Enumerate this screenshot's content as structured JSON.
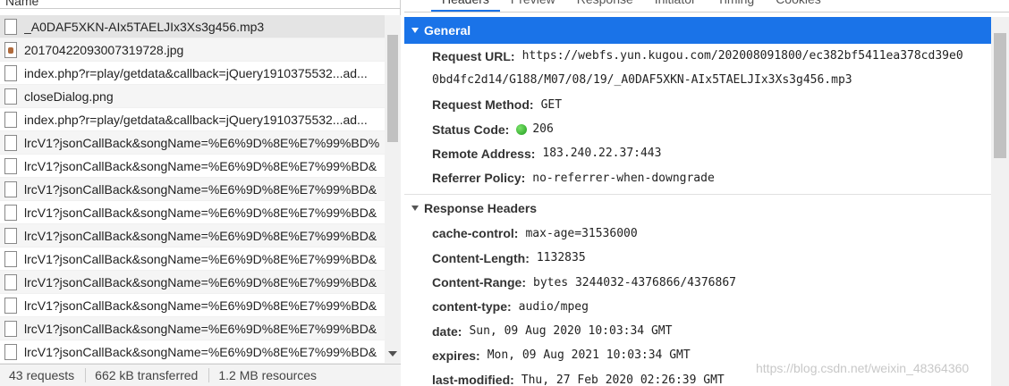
{
  "network_list": {
    "column_header": "Name",
    "rows": [
      {
        "name": "_A0DAF5XKN-AIx5TAELJIx3Xs3g456.mp3",
        "icon": "file-icon",
        "selected": true
      },
      {
        "name": "20170422093007319728.jpg",
        "icon": "image-icon"
      },
      {
        "name": "index.php?r=play/getdata&callback=jQuery1910375532...ad...",
        "icon": "file-icon"
      },
      {
        "name": "closeDialog.png",
        "icon": "file-icon"
      },
      {
        "name": "index.php?r=play/getdata&callback=jQuery1910375532...ad...",
        "icon": "file-icon"
      },
      {
        "name": "lrcV1?jsonCallBack&songName=%E6%9D%8E%E7%99%BD%",
        "icon": "file-icon"
      },
      {
        "name": "lrcV1?jsonCallBack&songName=%E6%9D%8E%E7%99%BD&",
        "icon": "file-icon"
      },
      {
        "name": "lrcV1?jsonCallBack&songName=%E6%9D%8E%E7%99%BD&",
        "icon": "file-icon"
      },
      {
        "name": "lrcV1?jsonCallBack&songName=%E6%9D%8E%E7%99%BD&",
        "icon": "file-icon"
      },
      {
        "name": "lrcV1?jsonCallBack&songName=%E6%9D%8E%E7%99%BD&",
        "icon": "file-icon"
      },
      {
        "name": "lrcV1?jsonCallBack&songName=%E6%9D%8E%E7%99%BD&",
        "icon": "file-icon"
      },
      {
        "name": "lrcV1?jsonCallBack&songName=%E6%9D%8E%E7%99%BD&",
        "icon": "file-icon"
      },
      {
        "name": "lrcV1?jsonCallBack&songName=%E6%9D%8E%E7%99%BD&",
        "icon": "file-icon"
      },
      {
        "name": "lrcV1?jsonCallBack&songName=%E6%9D%8E%E7%99%BD&",
        "icon": "file-icon"
      },
      {
        "name": "lrcV1?jsonCallBack&songName=%E6%9D%8E%E7%99%BD&",
        "icon": "file-icon"
      }
    ]
  },
  "status_bar": {
    "requests": "43 requests",
    "transferred": "662 kB transferred",
    "resources": "1.2 MB resources"
  },
  "detail_tabs": [
    "Headers",
    "Preview",
    "Response",
    "Initiator",
    "Timing",
    "Cookies"
  ],
  "general": {
    "title": "General",
    "request_url_label": "Request URL:",
    "request_url_line1": "https://webfs.yun.kugou.com/202008091800/ec382bf5411ea378cd39e0",
    "request_url_line2": "0bd4fc2d14/G188/M07/08/19/_A0DAF5XKN-AIx5TAELJIx3Xs3g456.mp3",
    "request_method_label": "Request Method:",
    "request_method": "GET",
    "status_code_label": "Status Code:",
    "status_code": "206",
    "remote_address_label": "Remote Address:",
    "remote_address": "183.240.22.37:443",
    "referrer_policy_label": "Referrer Policy:",
    "referrer_policy": "no-referrer-when-downgrade"
  },
  "response_headers": {
    "title": "Response Headers",
    "items": [
      {
        "key": "cache-control:",
        "value": "max-age=31536000"
      },
      {
        "key": "Content-Length:",
        "value": "1132835"
      },
      {
        "key": "Content-Range:",
        "value": "bytes 3244032-4376866/4376867"
      },
      {
        "key": "content-type:",
        "value": "audio/mpeg"
      },
      {
        "key": "date:",
        "value": "Sun, 09 Aug 2020 10:03:34 GMT"
      },
      {
        "key": "expires:",
        "value": "Mon, 09 Aug 2021 10:03:34 GMT"
      },
      {
        "key": "last-modified:",
        "value": "Thu, 27 Feb 2020 02:26:39 GMT"
      }
    ]
  },
  "watermark": "https://blog.csdn.net/weixin_48364360",
  "colors": {
    "accent": "#1a73e8",
    "status_ok": "#2db52d"
  }
}
